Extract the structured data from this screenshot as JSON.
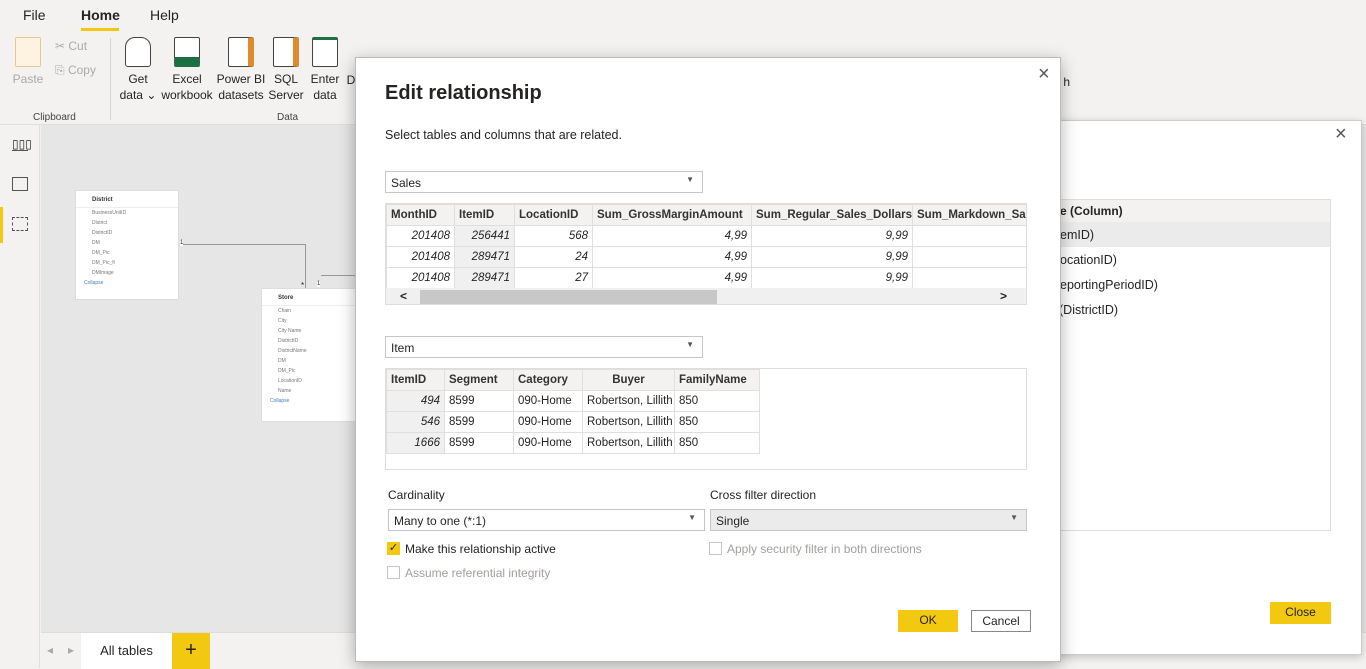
{
  "menu": {
    "file": "File",
    "home": "Home",
    "help": "Help"
  },
  "ribbon": {
    "paste": "Paste",
    "cut": "Cut",
    "copy": "Copy",
    "clipboard_group": "Clipboard",
    "get_data": "Get",
    "get_data2": "data",
    "excel": "Excel",
    "excel2": "workbook",
    "pbi": "Power BI",
    "pbi2": "datasets",
    "sql": "SQL",
    "sql2": "Server",
    "enter": "Enter",
    "enter2": "data",
    "d_partial": "D",
    "data_group": "Data",
    "h_partial": "h"
  },
  "model": {
    "district": {
      "title": "District",
      "fields": [
        "BusinessUnitID",
        "District",
        "DistrictID",
        "DM",
        "DM_Pic",
        "DM_Pic_fl",
        "DMImage"
      ],
      "collapse": "Collapse"
    },
    "store": {
      "title": "Store",
      "fields": [
        "Chain",
        "City",
        "City Name",
        "DistrictID",
        "DistrictName",
        "DM",
        "DM_Pic",
        "LocationID",
        "Name"
      ],
      "collapse": "Collapse"
    },
    "card_one": "1",
    "card_many": "*"
  },
  "bottom_tabs": {
    "all_tables": "All tables",
    "add": "+"
  },
  "back_dialog": {
    "header": "e (Column)",
    "rows": [
      "emID)",
      "ocationID)",
      "eportingPeriodID)",
      "(DistrictID)"
    ],
    "close_button": "Close"
  },
  "dialog": {
    "title": "Edit relationship",
    "subtitle": "Select tables and columns that are related.",
    "table1": {
      "selected": "Sales",
      "columns": [
        "MonthID",
        "ItemID",
        "LocationID",
        "Sum_GrossMarginAmount",
        "Sum_Regular_Sales_Dollars",
        "Sum_Markdown_Sale"
      ],
      "rows": [
        [
          "201408",
          "256441",
          "568",
          "4,99",
          "9,99",
          ""
        ],
        [
          "201408",
          "289471",
          "24",
          "4,99",
          "9,99",
          ""
        ],
        [
          "201408",
          "289471",
          "27",
          "4,99",
          "9,99",
          ""
        ]
      ]
    },
    "table2": {
      "selected": "Item",
      "columns": [
        "ItemID",
        "Segment",
        "Category",
        "Buyer",
        "FamilyName"
      ],
      "rows": [
        [
          "494",
          "8599",
          "090-Home",
          "Robertson, Lillith",
          "850"
        ],
        [
          "546",
          "8599",
          "090-Home",
          "Robertson, Lillith",
          "850"
        ],
        [
          "1666",
          "8599",
          "090-Home",
          "Robertson, Lillith",
          "850"
        ]
      ]
    },
    "cardinality_label": "Cardinality",
    "cardinality_value": "Many to one (*:1)",
    "crossfilter_label": "Cross filter direction",
    "crossfilter_value": "Single",
    "active_label": "Make this relationship active",
    "active_checked": true,
    "security_label": "Apply security filter in both directions",
    "integrity_label": "Assume referential integrity",
    "ok": "OK",
    "cancel": "Cancel"
  },
  "colors": {
    "accent": "#f2c811"
  }
}
